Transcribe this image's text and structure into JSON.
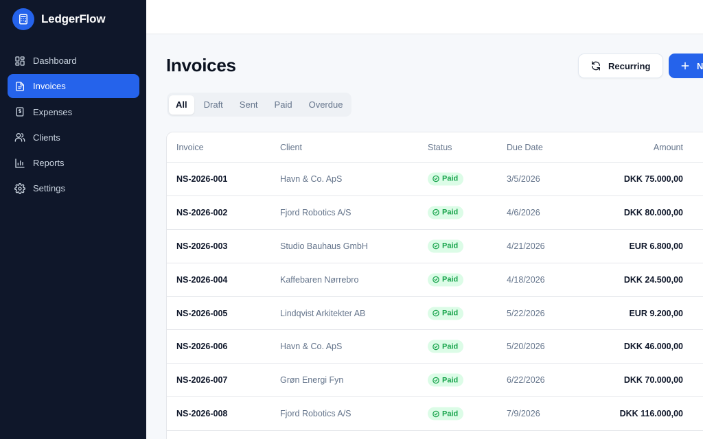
{
  "app": {
    "name": "LedgerFlow"
  },
  "sidebar": {
    "items": [
      {
        "label": "Dashboard",
        "icon": "dashboard-icon",
        "active": false
      },
      {
        "label": "Invoices",
        "icon": "file-text-icon",
        "active": true
      },
      {
        "label": "Expenses",
        "icon": "receipt-icon",
        "active": false
      },
      {
        "label": "Clients",
        "icon": "users-icon",
        "active": false
      },
      {
        "label": "Reports",
        "icon": "bar-chart-icon",
        "active": false
      },
      {
        "label": "Settings",
        "icon": "gear-icon",
        "active": false
      }
    ]
  },
  "page": {
    "title": "Invoices",
    "recurring_label": "Recurring",
    "new_label": "N"
  },
  "tabs": [
    {
      "label": "All",
      "active": true
    },
    {
      "label": "Draft",
      "active": false
    },
    {
      "label": "Sent",
      "active": false
    },
    {
      "label": "Paid",
      "active": false
    },
    {
      "label": "Overdue",
      "active": false
    }
  ],
  "table": {
    "headers": {
      "invoice": "Invoice",
      "client": "Client",
      "status": "Status",
      "due": "Due Date",
      "amount": "Amount"
    },
    "rows": [
      {
        "invoice": "NS-2026-001",
        "client": "Havn & Co. ApS",
        "status": "Paid",
        "due": "3/5/2026",
        "amount": "DKK 75.000,00"
      },
      {
        "invoice": "NS-2026-002",
        "client": "Fjord Robotics A/S",
        "status": "Paid",
        "due": "4/6/2026",
        "amount": "DKK 80.000,00"
      },
      {
        "invoice": "NS-2026-003",
        "client": "Studio Bauhaus GmbH",
        "status": "Paid",
        "due": "4/21/2026",
        "amount": "EUR 6.800,00"
      },
      {
        "invoice": "NS-2026-004",
        "client": "Kaffebaren Nørrebro",
        "status": "Paid",
        "due": "4/18/2026",
        "amount": "DKK 24.500,00"
      },
      {
        "invoice": "NS-2026-005",
        "client": "Lindqvist Arkitekter AB",
        "status": "Paid",
        "due": "5/22/2026",
        "amount": "EUR 9.200,00"
      },
      {
        "invoice": "NS-2026-006",
        "client": "Havn & Co. ApS",
        "status": "Paid",
        "due": "5/20/2026",
        "amount": "DKK 46.000,00"
      },
      {
        "invoice": "NS-2026-007",
        "client": "Grøn Energi Fyn",
        "status": "Paid",
        "due": "6/22/2026",
        "amount": "DKK 70.000,00"
      },
      {
        "invoice": "NS-2026-008",
        "client": "Fjord Robotics A/S",
        "status": "Paid",
        "due": "7/9/2026",
        "amount": "DKK 116.000,00"
      }
    ]
  },
  "colors": {
    "accent": "#2563eb",
    "sidebar_bg": "#0f172a",
    "paid_bg": "#dcfce7",
    "paid_fg": "#16a34a"
  }
}
